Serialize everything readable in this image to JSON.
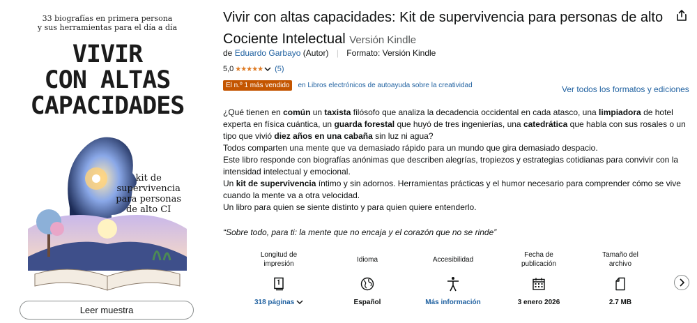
{
  "cover": {
    "subtitle_top": "33 biografías en primera persona\ny sus herramientas para el día a día",
    "title": "VIVIR\nCON ALTAS\nCAPACIDADES",
    "kit_text": "kit de\nsupervivencia\npara personas\nde alto CI"
  },
  "sample_button": "Leer muestra",
  "product": {
    "title": "Vivir con altas capacidades: Kit de supervivencia para personas de alto Cociente Intelectual",
    "edition": "Versión Kindle",
    "by_prefix": "de",
    "author": "Eduardo Garbayo",
    "author_role": "(Autor)",
    "format_label": "Formato:",
    "format_value": "Versión Kindle",
    "rating_value": "5,0",
    "rating_count": "(5)",
    "badge": "El n.º 1 más vendido",
    "badge_category": "en Libros electrónicos de autoayuda sobre la creatividad",
    "formats_link": "Ver todos los formatos y ediciones"
  },
  "description": {
    "p1_a": "¿Qué tienen en ",
    "p1_b": "común",
    "p1_c": " un ",
    "p1_d": "taxista",
    "p1_e": " filósofo que analiza la decadencia occidental en cada atasco, una ",
    "p1_f": "limpiadora",
    "p1_g": " de hotel experta en física cuántica, un ",
    "p1_h": "guarda forestal",
    "p1_i": " que huyó de tres ingenierías, una ",
    "p1_j": "catedrática",
    "p1_k": " que habla con sus rosales o un tipo que vivió ",
    "p1_l": "diez años en una cabaña",
    "p1_m": " sin luz ni agua?",
    "p2": "Todos comparten una mente que va demasiado rápido para un mundo que gira demasiado despacio.",
    "p3": "Este libro responde con biografías anónimas que describen alegrías, tropiezos y estrategias cotidianas para convivir con la intensidad intelectual y emocional.",
    "p4_a": "Un ",
    "p4_b": "kit de supervivencia",
    "p4_c": " íntimo y sin adornos. Herramientas prácticas y el humor necesario para comprender cómo se vive cuando la mente va a otra velocidad.",
    "p5": "Un libro para quien se siente distinto y para quien quiere entenderlo.",
    "quote": "“Sobre todo, para ti: la mente que no encaja y el corazón que no se rinde”"
  },
  "attributes": [
    {
      "label": "Longitud de\nimpresión",
      "icon": "book-pages-icon",
      "value": "318 páginas"
    },
    {
      "label": "Idioma",
      "icon": "globe-icon",
      "value": "Español"
    },
    {
      "label": "Accesibilidad",
      "icon": "accessibility-person-icon",
      "value": "Más información"
    },
    {
      "label": "Fecha de\npublicación",
      "icon": "calendar-icon",
      "value": "3 enero 2026"
    },
    {
      "label": "Tamaño del\narchivo",
      "icon": "file-icon",
      "value": "2.7 MB"
    }
  ],
  "colors": {
    "link": "#2162a1",
    "badge": "#c45500",
    "stars": "#de7921"
  }
}
